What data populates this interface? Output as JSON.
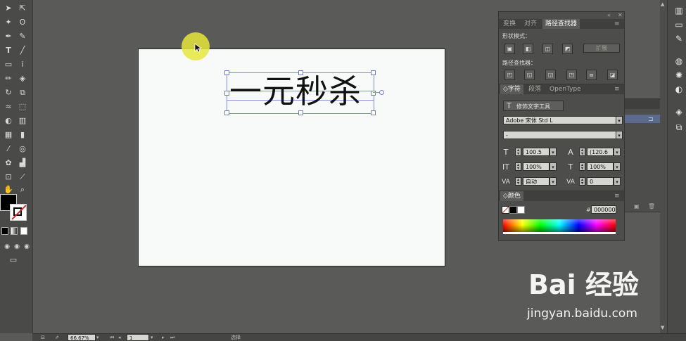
{
  "canvas": {
    "headline": "一元秒杀"
  },
  "panel_top": {
    "tabs": [
      "变换",
      "对齐",
      "路径查找器"
    ],
    "shape_modes_label": "形状模式：",
    "expand_label": "扩展",
    "pathfinder_label": "路径查找器："
  },
  "char_panel": {
    "tabs": [
      "◇字符",
      "段落",
      "OpenType"
    ],
    "touch_type_label": "修饰文字工具",
    "font_family": "Adobe 宋体 Std L",
    "font_style": "-",
    "font_size": "100.5",
    "leading": "(120.6",
    "vertical_scale": "100%",
    "horizontal_scale": "100%",
    "kerning": "自动",
    "tracking": "0"
  },
  "color_panel": {
    "tab": "◇颜色",
    "hex_label": "#",
    "hex_value": "000000",
    "fill_color": "#000000",
    "stroke_color": "#ffffff"
  },
  "status_bar": {
    "zoom": "66.67%",
    "page": "1",
    "tool": "选择"
  },
  "watermark": {
    "logo": "Bai 经验",
    "url": "jingyan.baidu.com"
  },
  "icons": {
    "selection": "selection-icon",
    "direct_selection": "direct-selection-icon",
    "magic_wand": "magic-wand-icon",
    "lasso": "lasso-icon",
    "pen": "pen-icon",
    "type": "type-icon",
    "line": "line-icon",
    "rectangle": "rectangle-icon",
    "brush": "brush-icon",
    "pencil": "pencil-icon",
    "eraser": "eraser-icon",
    "rotate": "rotate-icon",
    "scale": "scale-icon",
    "warp": "warp-icon",
    "free_transform": "free-transform-icon",
    "shape_builder": "shape-builder-icon",
    "perspective": "perspective-icon",
    "mesh": "mesh-icon",
    "gradient": "gradient-icon",
    "eyedropper": "eyedropper-icon",
    "blend": "blend-icon",
    "symbol_sprayer": "symbol-sprayer-icon",
    "column_graph": "column-graph-icon",
    "artboard": "artboard-icon",
    "slice": "slice-icon",
    "hand": "hand-icon",
    "zoom": "zoom-icon"
  }
}
